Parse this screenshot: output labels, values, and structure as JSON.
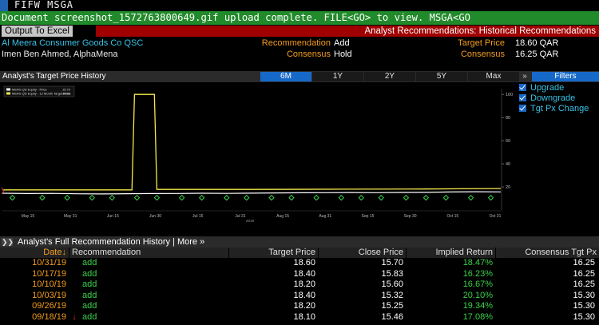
{
  "command": {
    "text": "FIFW MSGA"
  },
  "status": {
    "text": "Document screenshot_1572763800649.gif upload complete. FILE<GO> to view. MSGA<GO"
  },
  "header": {
    "export_label": "Output To Excel",
    "title": "Analyst Recommendations: Historical Recommendations"
  },
  "info": {
    "company": "Al Meera Consumer Goods Co QSC",
    "analyst": "Imen Ben Ahmed, AlphaMena",
    "recommendation_label": "Recommendation",
    "recommendation_value": "Add",
    "consensus_label": "Consensus",
    "consensus_value": "Hold",
    "target_price_label": "Target Price",
    "target_price_value": "18.60 QAR",
    "consensus_price_label": "Consensus",
    "consensus_price_value": "16.25 QAR"
  },
  "chart_header": {
    "title": "Analyst's Target Price History",
    "ranges": [
      "6M",
      "1Y",
      "2Y",
      "5Y",
      "Max"
    ],
    "active_range": "6M",
    "expand": "»",
    "filters_label": "Filters"
  },
  "legend": {
    "items": [
      "Upgrade",
      "Downgrade",
      "Tgt Px Change"
    ],
    "colors": {
      "upgrade": "#1769c9",
      "text": "#39c2e6"
    }
  },
  "chart_data": {
    "type": "line",
    "legend_entries": [
      {
        "name": "MERS QD Equity - Price",
        "last": "15.70",
        "color": "#ffffff"
      },
      {
        "name": "MERS QD Equity - 12 Month Target Price",
        "last": "18.60",
        "color": "#f5e94a"
      }
    ],
    "x_ticks": [
      "May 15",
      "May 31",
      "Jun 15",
      "Jun 30",
      "Jul 15",
      "Jul 31",
      "Aug 15",
      "Aug 31",
      "Sep 15",
      "Sep 30",
      "Oct 15",
      "Oct 31"
    ],
    "x_year_label": "2019",
    "y_ticks": [
      20,
      40,
      60,
      80,
      100
    ],
    "ylim": [
      0,
      105
    ],
    "price": [
      [
        0,
        14.5
      ],
      [
        0.05,
        14.2
      ],
      [
        0.1,
        14.4
      ],
      [
        0.15,
        14.0
      ],
      [
        0.2,
        13.9
      ],
      [
        0.25,
        14.1
      ],
      [
        0.3,
        14.2
      ],
      [
        0.35,
        14.3
      ],
      [
        0.4,
        14.5
      ],
      [
        0.45,
        14.4
      ],
      [
        0.5,
        14.6
      ],
      [
        0.55,
        14.8
      ],
      [
        0.6,
        14.9
      ],
      [
        0.65,
        15.0
      ],
      [
        0.7,
        15.1
      ],
      [
        0.75,
        15.0
      ],
      [
        0.8,
        15.2
      ],
      [
        0.85,
        15.3
      ],
      [
        0.9,
        15.6
      ],
      [
        0.95,
        15.8
      ],
      [
        1.0,
        15.7
      ]
    ],
    "target": [
      [
        0,
        17.4
      ],
      [
        0.26,
        17.4
      ],
      [
        0.265,
        100
      ],
      [
        0.305,
        100
      ],
      [
        0.31,
        17.8
      ],
      [
        0.5,
        17.8
      ],
      [
        0.7,
        18.0
      ],
      [
        0.85,
        18.2
      ],
      [
        0.92,
        18.4
      ],
      [
        1.0,
        18.6
      ]
    ],
    "markers": [
      0.02,
      0.08,
      0.13,
      0.18,
      0.22,
      0.27,
      0.31,
      0.36,
      0.4,
      0.45,
      0.49,
      0.54,
      0.58,
      0.63,
      0.68,
      0.72,
      0.76,
      0.81,
      0.85,
      0.89,
      0.94,
      0.98
    ],
    "marker_value": 12
  },
  "history": {
    "title": "Analyst's Full Recommendation History | More »",
    "columns": {
      "date": "Date",
      "recommendation": "Recommendation",
      "target_price": "Target Price",
      "close_price": "Close Price",
      "implied_return": "Implied Return",
      "consensus": "Consensus Tgt Px"
    },
    "rows": [
      {
        "date": "10/31/19",
        "arrow": "",
        "rec": "add",
        "tp": "18.60",
        "cp": "15.70",
        "ir": "18.47%",
        "cs": "16.25"
      },
      {
        "date": "10/17/19",
        "arrow": "",
        "rec": "add",
        "tp": "18.40",
        "cp": "15.83",
        "ir": "16.23%",
        "cs": "16.25"
      },
      {
        "date": "10/10/19",
        "arrow": "",
        "rec": "add",
        "tp": "18.20",
        "cp": "15.60",
        "ir": "16.67%",
        "cs": "16.25"
      },
      {
        "date": "10/03/19",
        "arrow": "",
        "rec": "add",
        "tp": "18.40",
        "cp": "15.32",
        "ir": "20.10%",
        "cs": "15.30"
      },
      {
        "date": "09/26/19",
        "arrow": "",
        "rec": "add",
        "tp": "18.20",
        "cp": "15.25",
        "ir": "19.34%",
        "cs": "15.30"
      },
      {
        "date": "09/18/19",
        "arrow": "↓",
        "rec": "add",
        "tp": "18.10",
        "cp": "15.46",
        "ir": "17.08%",
        "cs": "15.30"
      }
    ]
  }
}
